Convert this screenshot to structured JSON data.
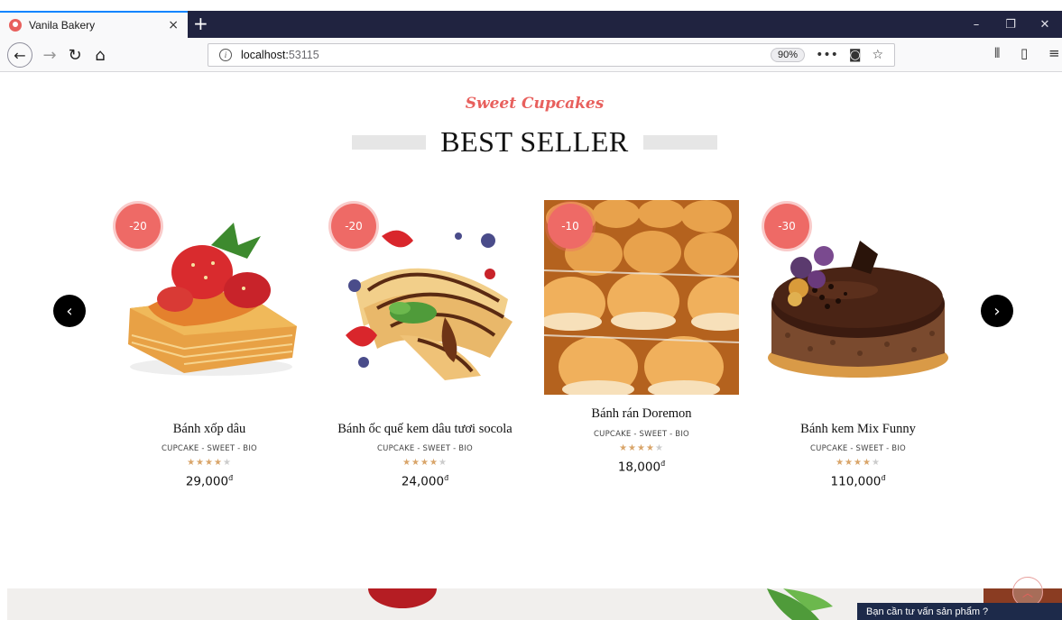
{
  "browser": {
    "tab_title": "Vanila Bakery",
    "tab_close": "×",
    "new_tab": "+",
    "url_host": "localhost:",
    "url_port": "53115",
    "zoom": "90%",
    "window_controls": [
      "–",
      "❐",
      "✕"
    ]
  },
  "section": {
    "subtitle": "Sweet Cupcakes",
    "title": "BEST SELLER"
  },
  "products": [
    {
      "name": "Bánh xốp dâu",
      "tags": "CUPCAKE - SWEET - BIO",
      "price": "29,000",
      "currency": "đ",
      "discount": "-20",
      "rating": 4
    },
    {
      "name": "Bánh ốc quế kem dâu tươi socola",
      "tags": "CUPCAKE - SWEET - BIO",
      "price": "24,000",
      "currency": "đ",
      "discount": "-20",
      "rating": 4
    },
    {
      "name": "Bánh rán Doremon",
      "tags": "CUPCAKE - SWEET - BIO",
      "price": "18,000",
      "currency": "đ",
      "discount": "-10",
      "rating": 4
    },
    {
      "name": "Bánh kem Mix Funny",
      "tags": "CUPCAKE - SWEET - BIO",
      "price": "110,000",
      "currency": "đ",
      "discount": "-30",
      "rating": 4
    }
  ],
  "chat": {
    "label": "Bạn cần tư vấn sản phẩm ?"
  },
  "colors": {
    "accent": "#e8605d",
    "badge": "#ee6a66",
    "chat_bg": "#1d2a4a",
    "star": "#d9a56a"
  },
  "icons": [
    "back-arrow-icon",
    "forward-arrow-icon",
    "reload-icon",
    "home-icon",
    "info-icon",
    "more-icon",
    "pocket-icon",
    "bookmark-star-icon",
    "library-icon",
    "sidebar-icon",
    "menu-icon",
    "chevron-left-icon",
    "chevron-right-icon",
    "chevron-up-icon"
  ]
}
